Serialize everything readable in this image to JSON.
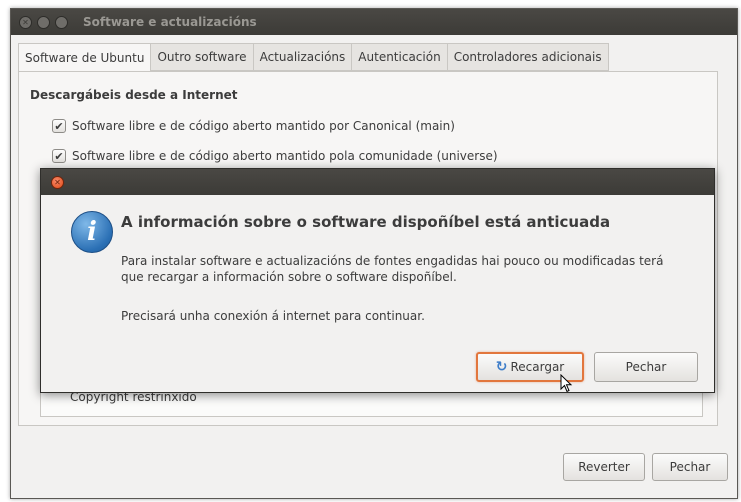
{
  "window": {
    "title": "Software e actualizacións"
  },
  "tabs": [
    {
      "label": "Software de Ubuntu",
      "active": true
    },
    {
      "label": "Outro software",
      "active": false
    },
    {
      "label": "Actualizacións",
      "active": false
    },
    {
      "label": "Autenticación",
      "active": false
    },
    {
      "label": "Controladores adicionais",
      "active": false
    }
  ],
  "downloadable": {
    "section_title": "Descargábeis desde a Internet",
    "items": [
      {
        "label": "Software libre e de código aberto mantido por Canonical (main)",
        "checked": true
      },
      {
        "label": "Software libre e de código aberto mantido pola comunidade (universe)",
        "checked": true
      }
    ]
  },
  "copyright_label": "Copyright restrinxido",
  "bottom_buttons": {
    "revert": "Reverter",
    "close": "Pechar"
  },
  "dialog": {
    "heading": "A información sobre o software dispoñíbel está anticuada",
    "body": "Para instalar software e actualizacións de fontes engadidas hai pouco ou modificadas terá que recargar a información sobre o software dispoñíbel.",
    "body2": "Precisará unha conexión á internet para continuar.",
    "reload_label": "Recargar",
    "close_label": "Pechar",
    "icon": "info-icon"
  },
  "colors": {
    "titlebar": "#3c3b37",
    "close_button": "#df4a16",
    "default_button_border": "#e2763d",
    "info_icon": "#2a6fb4"
  }
}
